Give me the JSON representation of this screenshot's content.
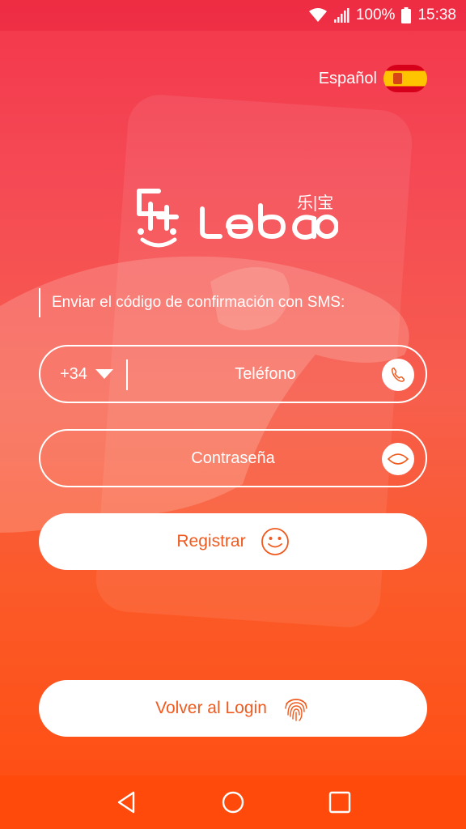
{
  "status_bar": {
    "battery": "100%",
    "time": "15:38",
    "icons": [
      "wifi-icon",
      "signal-icon",
      "battery-icon"
    ]
  },
  "language": {
    "label": "Español",
    "flag": "spain-flag-icon"
  },
  "logo": {
    "name_latin": "Lebao",
    "name_chinese": "乐|宝"
  },
  "form": {
    "hint": "Enviar el código de confirmación con SMS:",
    "country_code": "+34",
    "phone_placeholder": "Teléfono",
    "password_placeholder": "Contraseña",
    "register_label": "Registrar",
    "back_label": "Volver al Login"
  },
  "colors": {
    "gradient_top": "#f3364b",
    "gradient_bottom": "#ff4d0f",
    "accent_text": "#f05a1e"
  }
}
